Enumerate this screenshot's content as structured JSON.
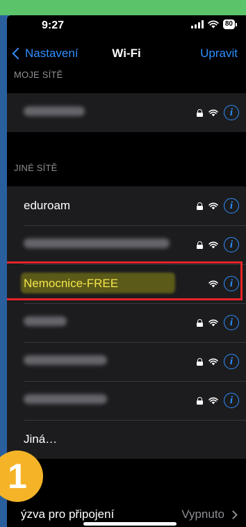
{
  "status_bar": {
    "time": "9:27",
    "battery": "80"
  },
  "nav": {
    "back_label": "Nastavení",
    "title": "Wi-Fi",
    "edit_label": "Upravit"
  },
  "my_networks": {
    "header": "MOJE SÍTĚ",
    "items": [
      {
        "name_blurred": true,
        "secured": true
      }
    ]
  },
  "other_networks": {
    "header": "JINÉ SÍTĚ",
    "items": [
      {
        "name": "eduroam",
        "secured": true
      },
      {
        "name_blurred": true,
        "secured": true
      },
      {
        "name": "Nemocnice-FREE",
        "secured": false,
        "highlighted": true
      },
      {
        "name_blurred": true,
        "secured": true
      },
      {
        "name_blurred": true,
        "secured": true
      },
      {
        "name_blurred": true,
        "secured": true
      },
      {
        "name": "Jiná…"
      }
    ]
  },
  "ask_to_join": {
    "label": "ýzva pro připojení",
    "value": "Vypnuto"
  },
  "annotation": {
    "step_number": "1",
    "highlight_color": "#e8232a",
    "badge_color": "#f5b428"
  },
  "colors": {
    "accent": "#2f8fff",
    "background": "#000000",
    "cell": "#1c1c1e"
  }
}
